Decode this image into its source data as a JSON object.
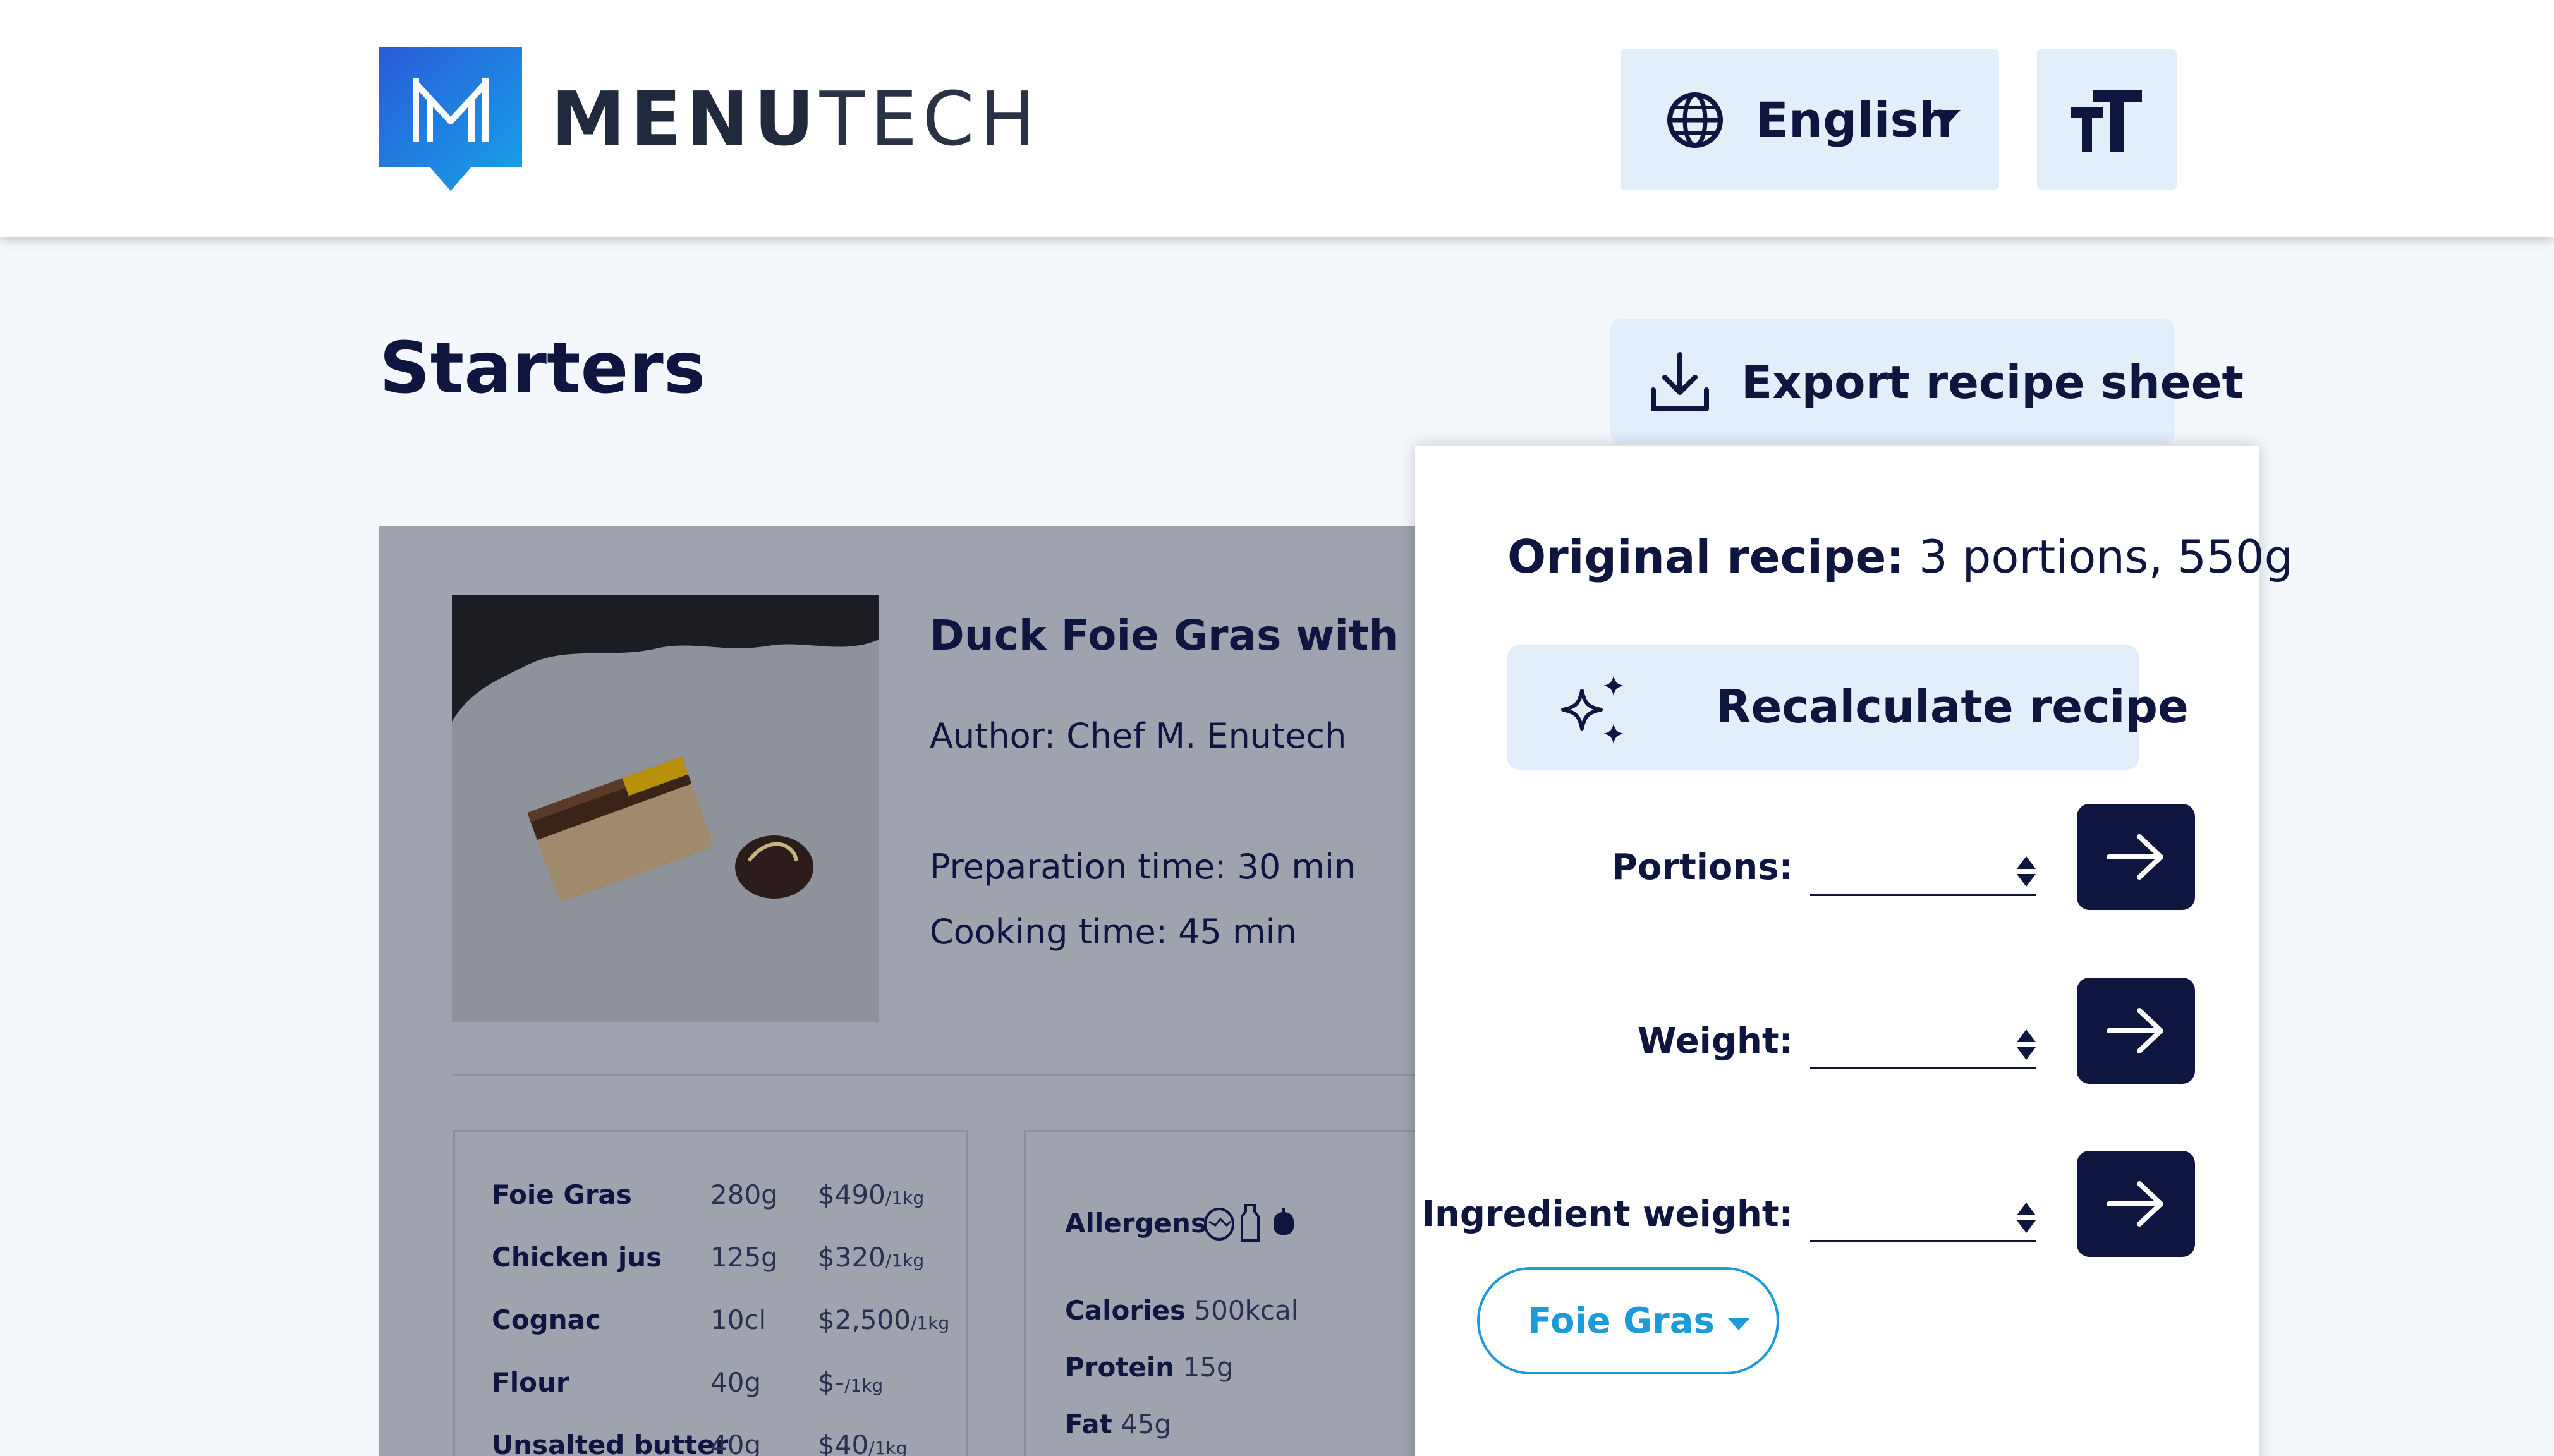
{
  "header": {
    "logo_bold": "MENU",
    "logo_light": "TECH",
    "language": "English",
    "text_size_icon": "text-size-icon"
  },
  "page": {
    "title": "Starters",
    "export_label": "Export recipe sheet"
  },
  "recipe": {
    "title": "Duck Foie Gras with Dul",
    "author": "Author: Chef M. Enutech",
    "prep_time": "Preparation time: 30 min",
    "cook_time": "Cooking time: 45 min",
    "ingredients": [
      {
        "name": "Foie Gras",
        "qty": "280g",
        "price": "$490",
        "unit": "/1kg"
      },
      {
        "name": "Chicken jus",
        "qty": "125g",
        "price": "$320",
        "unit": "/1kg"
      },
      {
        "name": "Cognac",
        "qty": "10cl",
        "price": "$2,500",
        "unit": "/1kg"
      },
      {
        "name": "Flour",
        "qty": "40g",
        "price": "$-",
        "unit": "/1kg"
      },
      {
        "name": "Unsalted butter",
        "qty": "40g",
        "price": "$40",
        "unit": "/1kg"
      }
    ],
    "allergens_label": "Allergens",
    "allergen_icons": [
      "egg-icon",
      "milk-bottle-icon",
      "nut-icon"
    ],
    "nutrition": [
      {
        "k": "Calories",
        "v": "500kcal"
      },
      {
        "k": "Protein",
        "v": "15g"
      },
      {
        "k": "Fat",
        "v": "45g"
      }
    ]
  },
  "recalc_panel": {
    "original_label": "Original recipe:",
    "original_value": " 3 portions, 550g",
    "recalc_label": "Recalculate recipe",
    "portions_label": "Portions:",
    "weight_label": "Weight:",
    "ingredient_weight_label": "Ingredient weight:",
    "portions_value": "",
    "weight_value": "",
    "ingredient_weight_value": "",
    "ingredient_select": "Foie Gras"
  },
  "colors": {
    "navy": "#0e1640",
    "light_blue": "#e2effb",
    "accent_blue": "#1d9bd8",
    "overlay_gray": "#9ea3ae"
  }
}
